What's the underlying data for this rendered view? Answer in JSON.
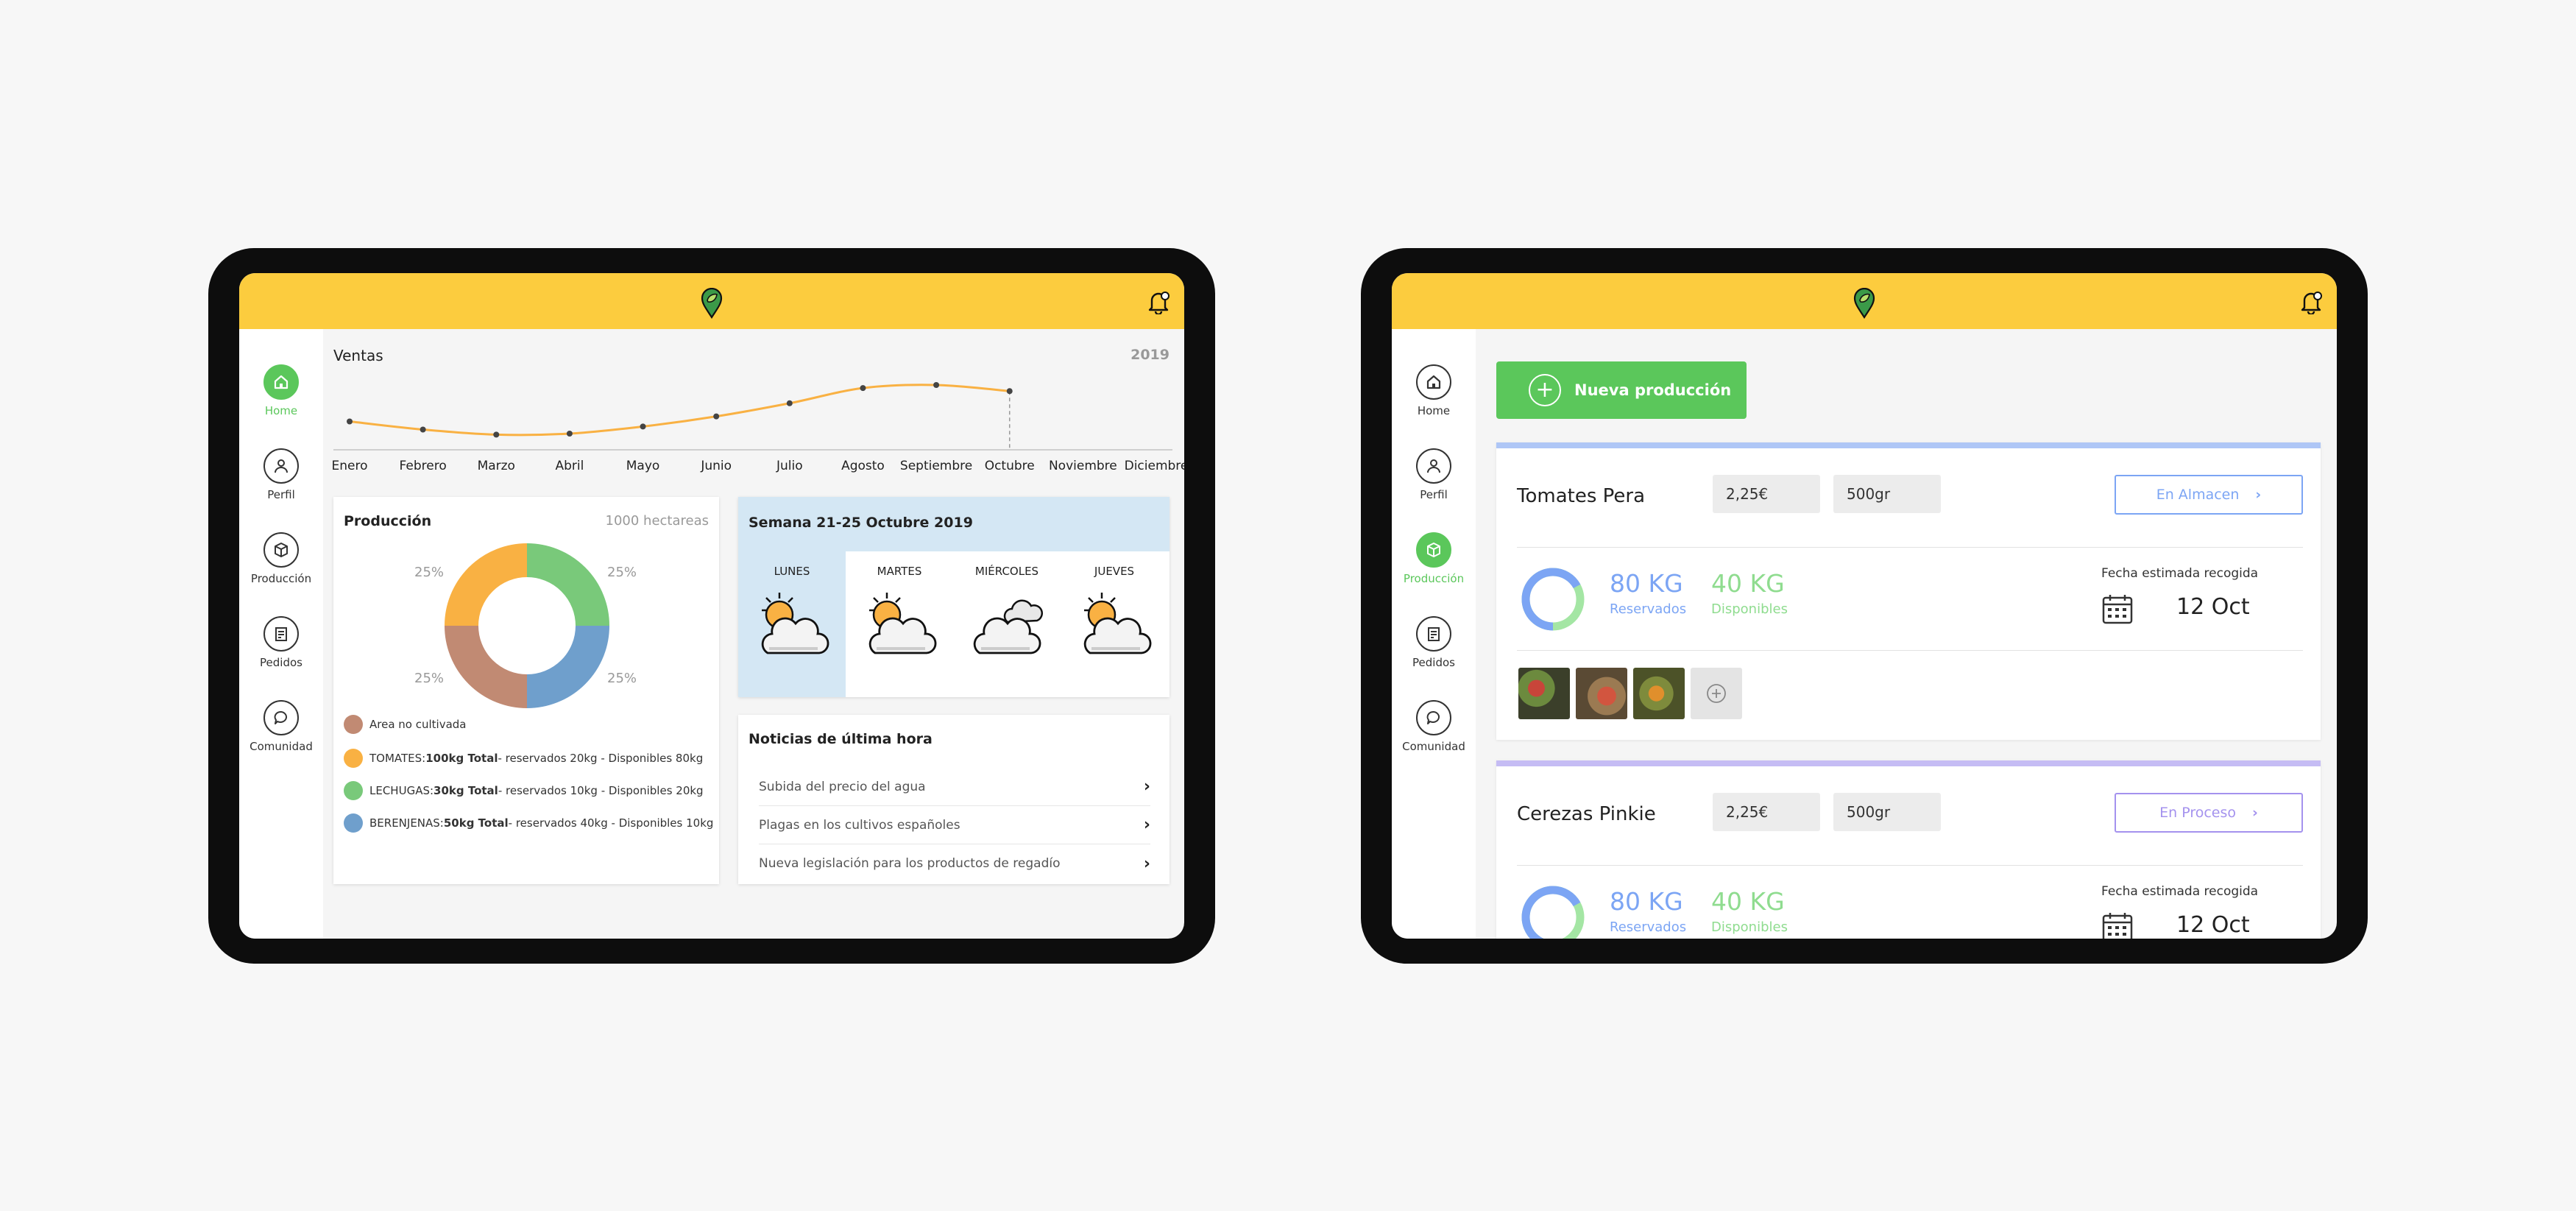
{
  "colors": {
    "brand_yellow": "#fccc3e",
    "green": "#5bc75b",
    "blue": "#7ca5f4",
    "purple": "#a492ee",
    "tomato_orange": "#f9b143",
    "brown": "#c18a73",
    "lettuce_green": "#79c97a",
    "eggplant_blue": "#6f9fcc"
  },
  "icons": {
    "logo": "map-pin-leaf-icon",
    "bell": "bell-icon",
    "home": "home-icon",
    "profile": "user-icon",
    "production": "box-icon",
    "orders": "receipt-icon",
    "community": "chat-icon"
  },
  "sidebar": {
    "items": [
      {
        "label": "Home"
      },
      {
        "label": "Perfil"
      },
      {
        "label": "Producción"
      },
      {
        "label": "Pedidos"
      },
      {
        "label": "Comunidad"
      }
    ]
  },
  "dashboard": {
    "sales": {
      "title": "Ventas",
      "year": "2019"
    },
    "production": {
      "title": "Producción",
      "area": "1000 hectareas",
      "legend": [
        {
          "name": "Area no cultivada",
          "bold": "",
          "rest": ""
        },
        {
          "name": "TOMATES: ",
          "bold": "100kg Total",
          "rest": " - reservados 20kg - Disponibles 80kg"
        },
        {
          "name": "LECHUGAS: ",
          "bold": "30kg Total",
          "rest": " - reservados 10kg - Disponibles 20kg"
        },
        {
          "name": "BERENJENAS: ",
          "bold": "50kg Total",
          "rest": " - reservados 40kg - Disponibles 10kg"
        }
      ]
    },
    "weather": {
      "title": "Semana 21-25 Octubre 2019",
      "days": [
        {
          "name": "LUNES",
          "icon": "sun-behind-cloud-icon"
        },
        {
          "name": "MARTES",
          "icon": "sun-behind-cloud-icon"
        },
        {
          "name": "MIÉRCOLES",
          "icon": "clouds-icon"
        },
        {
          "name": "JUEVES",
          "icon": "sun-behind-cloud-icon"
        }
      ]
    },
    "news": {
      "title": "Noticias de última hora",
      "items": [
        "Subida del precio del agua",
        "Plagas en los cultivos españoles",
        "Nueva legislación para los productos de regadío"
      ]
    }
  },
  "chart_data": [
    {
      "type": "line",
      "title": "Ventas",
      "subtitle": "2019",
      "categories": [
        "Enero",
        "Febrero",
        "Marzo",
        "Abril",
        "Mayo",
        "Junio",
        "Julio",
        "Agosto",
        "Septiembre",
        "Octubre",
        "Noviembre",
        "Diciembre"
      ],
      "series": [
        {
          "values": [
            28,
            20,
            15,
            16,
            23,
            33,
            46,
            61,
            64,
            58
          ]
        }
      ],
      "ylim": [
        0,
        80
      ],
      "grid": false
    },
    {
      "type": "pie",
      "title": "Producción",
      "categories": [
        "Area no cultivada",
        "TOMATES",
        "LECHUGAS",
        "BERENJENAS"
      ],
      "values": [
        25,
        25,
        25,
        25
      ],
      "labels": [
        "25%",
        "25%",
        "25%",
        "25%"
      ]
    }
  ],
  "production_page": {
    "new_button": "Nueva producción",
    "products": [
      {
        "name": "Tomates Pera",
        "price": "2,25€",
        "weight": "500gr",
        "status": "En Almacen",
        "reserved_value": "80 KG",
        "reserved_label": "Reservados",
        "reserved_fraction": 0.67,
        "available_value": "40 KG",
        "available_label": "Disponibles",
        "date_label": "Fecha estimada recogida",
        "date": "12 Oct"
      },
      {
        "name": "Cerezas Pinkie",
        "price": "2,25€",
        "weight": "500gr",
        "status": "En Proceso",
        "reserved_value": "80 KG",
        "reserved_label": "Reservados",
        "reserved_fraction": 0.67,
        "available_value": "40 KG",
        "available_label": "Disponibles",
        "date_label": "Fecha estimada recogida",
        "date": "12 Oct"
      }
    ]
  }
}
